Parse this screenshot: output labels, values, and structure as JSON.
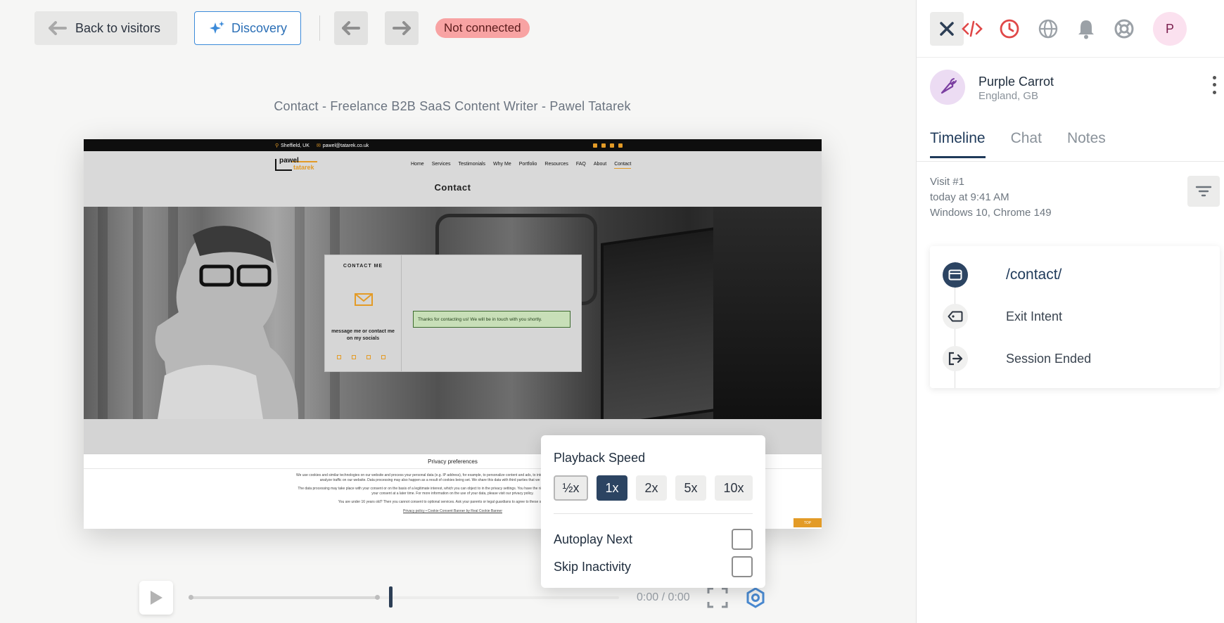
{
  "toolbar": {
    "back_label": "Back to visitors",
    "discovery_label": "Discovery",
    "status": "Not connected"
  },
  "recording": {
    "page_title": "Contact - Freelance B2B SaaS Content Writer - Pawel Tatarek",
    "site": {
      "location": "Sheffield, UK",
      "email": "pawel@tatarek.co.uk",
      "logo_line1": "pawel",
      "logo_line2": "tatarek",
      "nav": [
        "Home",
        "Services",
        "Testimonials",
        "Why Me",
        "Portfolio",
        "Resources",
        "FAQ",
        "About",
        "Contact"
      ],
      "heading": "Contact",
      "card_title": "CONTACT ME",
      "card_message": "message me or contact me on my socials",
      "success_message": "Thanks for contacting us! We will be in touch with you shortly.",
      "privacy_title": "Privacy preferences",
      "privacy_p1": "We use cookies and similar technologies on our website and process your personal data (e.g. IP address), for example, to personalize content and ads, to integrate media from third-party providers or to analyze traffic on our website. Data processing may also happen as a result of cookies being set. We share this data with third parties that we name in the privacy settings.",
      "privacy_p2": "The data processing may take place with your consent or on the basis of a legitimate interest, which you can object to in the privacy settings. You have the right not to consent and to change or revoke your consent at a later time. For more information on the use of your data, please visit our privacy policy.",
      "privacy_p3": "You are under 16 years old? Then you cannot consent to optional services. Ask your parents or legal guardians to agree to these services with you.",
      "privacy_links": "Privacy policy • Cookie Consent Banner by Real Cookie Banner",
      "top_badge": "TOP"
    }
  },
  "player": {
    "timecode": "0:00 / 0:00",
    "progress_fraction": 0.44,
    "speed_popup": {
      "title": "Playback Speed",
      "options": [
        "½x",
        "1x",
        "2x",
        "5x",
        "10x"
      ],
      "selected": "1x",
      "autoplay_label": "Autoplay Next",
      "autoplay_checked": false,
      "skip_label": "Skip Inactivity",
      "skip_checked": false
    }
  },
  "sidebar": {
    "avatar_initial": "P",
    "visitor_name": "Purple Carrot",
    "visitor_location": "England, GB",
    "tabs": [
      "Timeline",
      "Chat",
      "Notes"
    ],
    "active_tab": "Timeline",
    "visit": {
      "number": "Visit #1",
      "time": "today at 9:41 AM",
      "device": "Windows 10, Chrome 149"
    },
    "timeline": [
      {
        "label": "/contact/",
        "icon": "browser-page-icon"
      },
      {
        "label": "Exit Intent",
        "icon": "tag-icon"
      },
      {
        "label": "Session Ended",
        "icon": "exit-icon"
      }
    ]
  },
  "colors": {
    "accent": "#3b8ad9",
    "navy": "#2c4462",
    "status_bg": "#f8a3a3",
    "brand_orange": "#e39b27"
  }
}
